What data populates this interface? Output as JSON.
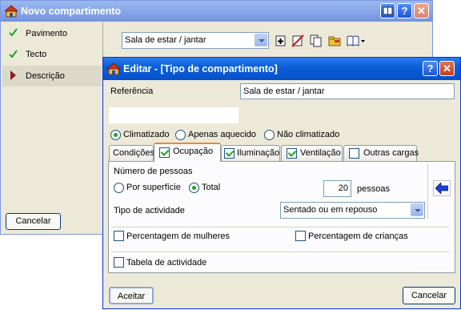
{
  "back_window": {
    "title": "Novo compartimento",
    "nav_items": [
      {
        "label": "Pavimento",
        "marker": "check"
      },
      {
        "label": "Tecto",
        "marker": "check"
      },
      {
        "label": "Descrição",
        "marker": "arrow"
      }
    ],
    "type_select": "Sala de estar / jantar",
    "cancel_label": "Cancelar"
  },
  "dialog": {
    "title": "Editar - [Tipo de compartimento]",
    "reference_label": "Referência",
    "reference_value": "Sala de estar / jantar",
    "climate_options": [
      "Climatizado",
      "Apenas aquecido",
      "Não climatizado"
    ],
    "climate_selected": "Climatizado",
    "tabs": [
      {
        "label": "Condições",
        "checkbox": false,
        "checked": false,
        "active": false
      },
      {
        "label": "Ocupação",
        "checkbox": true,
        "checked": true,
        "active": true
      },
      {
        "label": "Iluminação",
        "checkbox": true,
        "checked": true,
        "active": false
      },
      {
        "label": "Ventilação",
        "checkbox": true,
        "checked": true,
        "active": false
      },
      {
        "label": "Outras cargas",
        "checkbox": true,
        "checked": false,
        "active": false
      }
    ],
    "occupancy": {
      "people_label": "Número de pessoas",
      "by_area_label": "Por superfície",
      "total_label": "Total",
      "total_selected": true,
      "people_value": "20",
      "people_unit": "pessoas",
      "activity_label": "Tipo de actividade",
      "activity_value": "Sentado ou em repouso",
      "women_label": "Percentagem de mulheres",
      "children_label": "Percentagem de crianças",
      "activity_table_label": "Tabela de actividade"
    },
    "accept_label": "Aceitar",
    "cancel_label": "Cancelar"
  },
  "colors": {
    "titlebar_active": "#0a5fd8",
    "titlebar_inactive": "#7a96df",
    "check_green": "#21a121",
    "arrow_red": "#8b1a1a",
    "tab_accent": "#e68b2c"
  }
}
